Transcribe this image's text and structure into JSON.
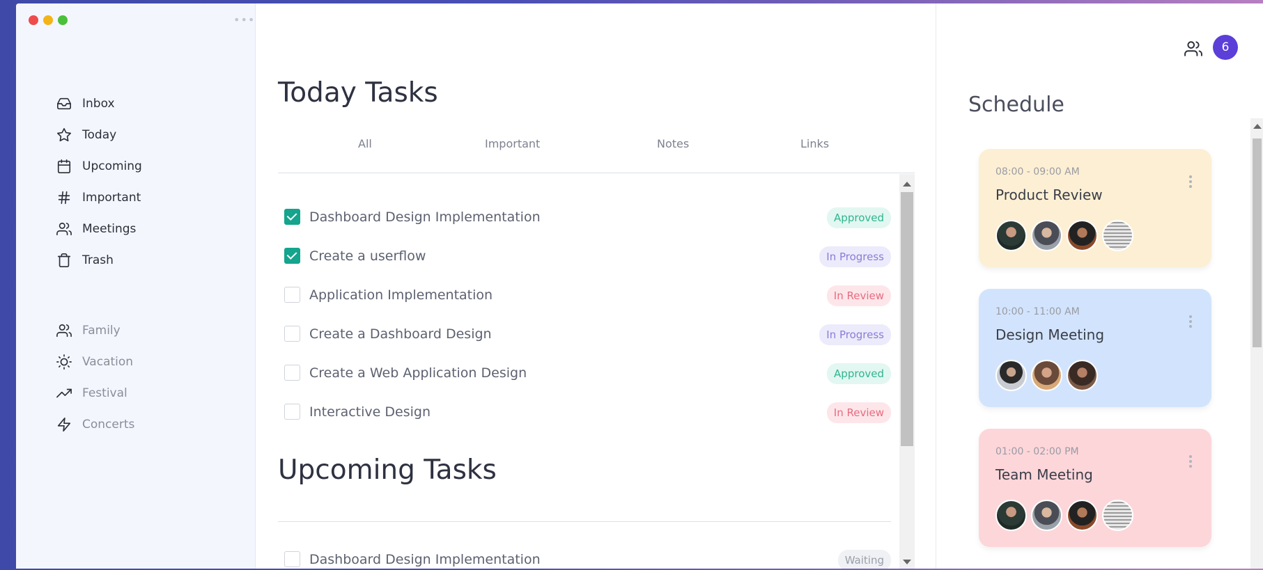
{
  "colors": {
    "accent": "#5b3fd8",
    "check": "#15a48d",
    "card_yellow": "#fdefd3",
    "card_blue": "#d2e4fd",
    "card_pink": "#fdd6da"
  },
  "sidebar": {
    "primary": [
      {
        "label": "Inbox",
        "icon": "inbox-icon"
      },
      {
        "label": "Today",
        "icon": "star-icon"
      },
      {
        "label": "Upcoming",
        "icon": "calendar-icon"
      },
      {
        "label": "Important",
        "icon": "hash-icon"
      },
      {
        "label": "Meetings",
        "icon": "users-icon"
      },
      {
        "label": "Trash",
        "icon": "trash-icon"
      }
    ],
    "secondary": [
      {
        "label": "Family",
        "icon": "users-icon"
      },
      {
        "label": "Vacation",
        "icon": "sun-icon"
      },
      {
        "label": "Festival",
        "icon": "trending-up-icon"
      },
      {
        "label": "Concerts",
        "icon": "zap-icon"
      }
    ]
  },
  "main": {
    "today_title": "Today Tasks",
    "tabs": [
      "All",
      "Important",
      "Notes",
      "Links"
    ],
    "today_tasks": [
      {
        "title": "Dashboard Design Implementation",
        "status": "Approved",
        "checked": true
      },
      {
        "title": "Create a userflow",
        "status": "In Progress",
        "checked": true
      },
      {
        "title": "Application Implementation",
        "status": "In Review",
        "checked": false
      },
      {
        "title": "Create a Dashboard Design",
        "status": "In Progress",
        "checked": false
      },
      {
        "title": "Create a Web Application Design",
        "status": "Approved",
        "checked": false
      },
      {
        "title": "Interactive Design",
        "status": "In Review",
        "checked": false
      }
    ],
    "upcoming_title": "Upcoming Tasks",
    "upcoming_tasks": [
      {
        "title": "Dashboard Design Implementation",
        "status": "Waiting",
        "checked": false
      }
    ]
  },
  "right": {
    "people_count": "6",
    "schedule_title": "Schedule",
    "events": [
      {
        "time": "08:00 - 09:00 AM",
        "title": "Product Review",
        "color": "#fdefd3",
        "attendees": 4
      },
      {
        "time": "10:00 - 11:00 AM",
        "title": "Design Meeting",
        "color": "#d2e4fd",
        "attendees": 3
      },
      {
        "time": "01:00 - 02:00 PM",
        "title": "Team Meeting",
        "color": "#fdd6da",
        "attendees": 4
      }
    ]
  }
}
